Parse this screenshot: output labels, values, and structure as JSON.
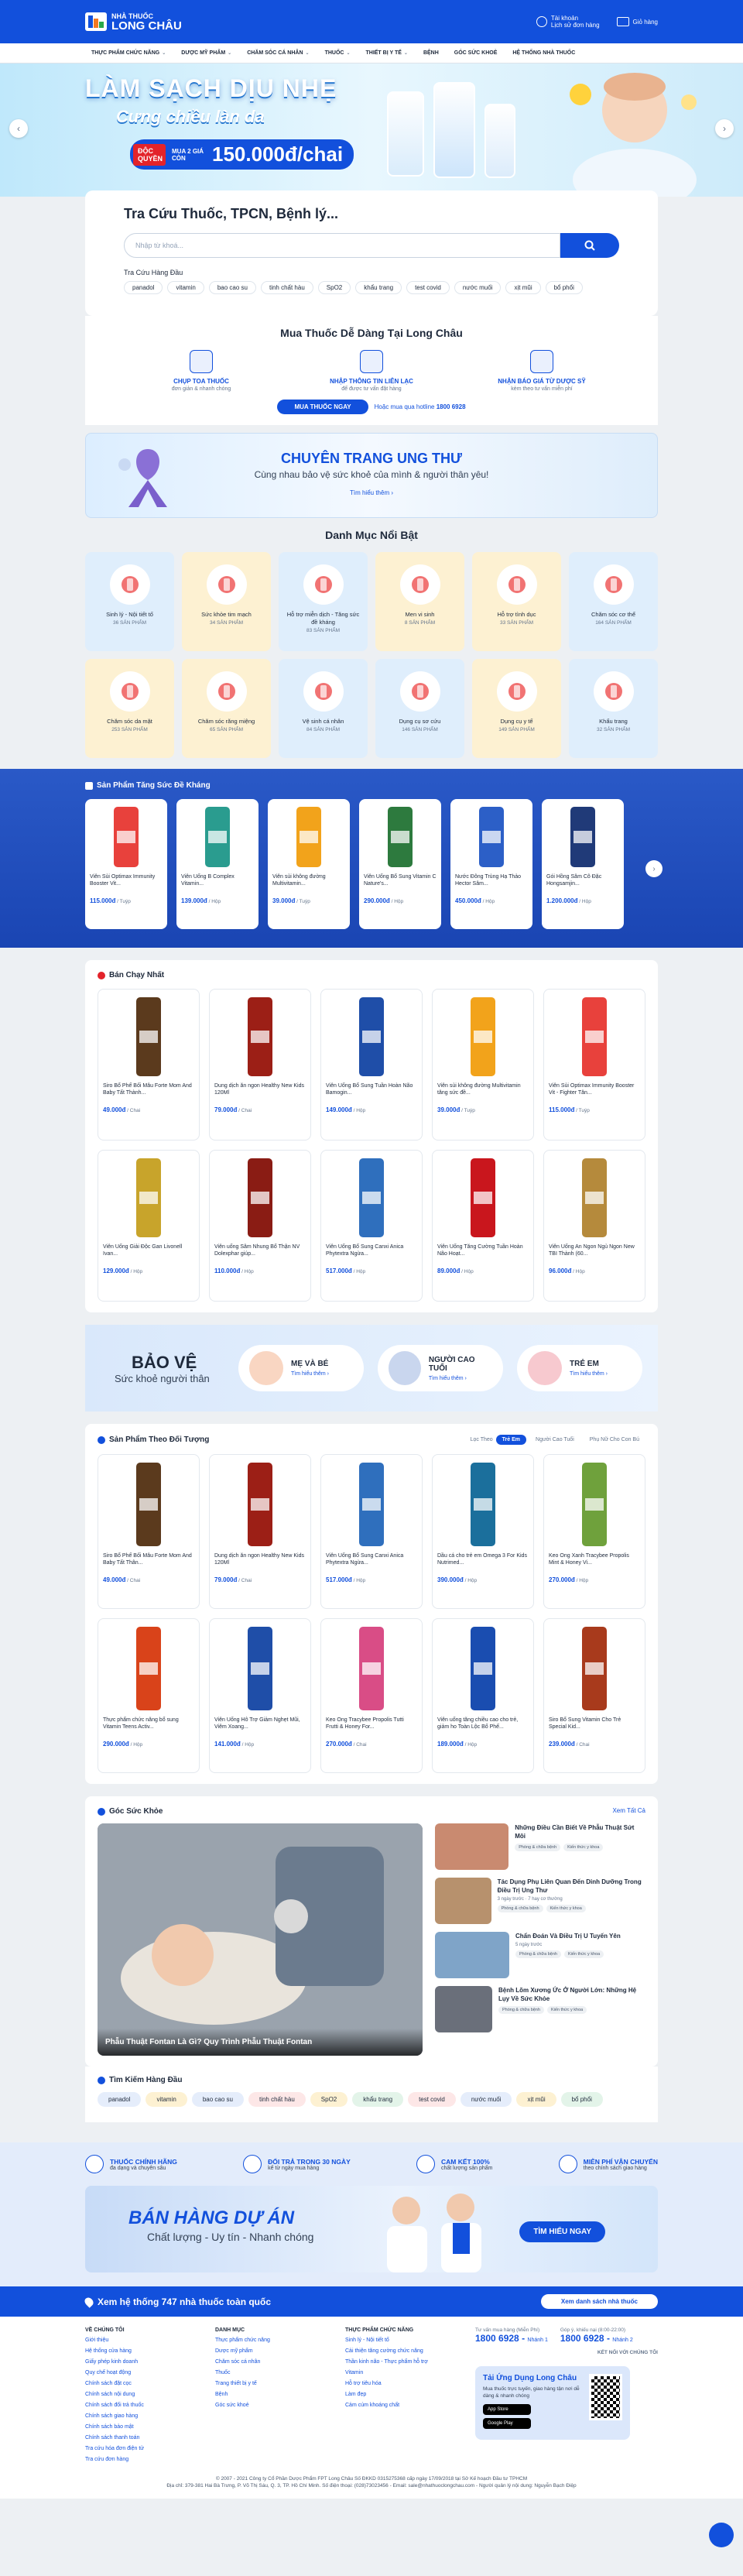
{
  "header": {
    "logo_small": "NHÀ THUỐC",
    "logo_big": "LONG CHÂU",
    "logo_brand": "FPT Retail",
    "account_line1": "Tài khoản",
    "account_line2": "Lịch sử đơn hàng",
    "cart": "Giỏ hàng"
  },
  "nav": [
    "THỰC PHẨM CHỨC NĂNG",
    "DƯỢC MỸ PHẨM",
    "CHĂM SÓC CÁ NHÂN",
    "THUỐC",
    "THIẾT BỊ Y TẾ",
    "BỆNH",
    "GÓC SỨC KHOẺ",
    "HỆ THỐNG NHÀ THUỐC"
  ],
  "banner": {
    "title": "LÀM SẠCH DỊU NHẸ",
    "subtitle": "Cưng chiều làn da",
    "tag": "ĐỘC QUYỀN",
    "deal": "MUA 2 GIÁ CÒN",
    "price": "150.000đ/chai"
  },
  "search": {
    "title": "Tra Cứu Thuốc, TPCN, Bệnh lý...",
    "placeholder": "Nhập từ khoá...",
    "top_label": "Tra Cứu Hàng Đầu",
    "chips": [
      "panadol",
      "vitamin",
      "bao cao su",
      "tinh chất hàu",
      "SpO2",
      "khẩu trang",
      "test covid",
      "nước muối",
      "xịt mũi",
      "bổ phổi"
    ]
  },
  "buy": {
    "title": "Mua Thuốc Dễ Dàng Tại Long Châu",
    "steps": [
      {
        "t": "CHỤP TOA THUỐC",
        "d": "đơn giản & nhanh chóng"
      },
      {
        "t": "NHẬP THÔNG TIN LIÊN LẠC",
        "d": "để được tư vấn đặt hàng"
      },
      {
        "t": "NHẬN BÁO GIÁ TỪ DƯỢC SỸ",
        "d": "kèm theo tư vấn miễn phí"
      }
    ],
    "button": "MUA THUỐC NGAY",
    "hotline_pre": "Hoặc mua qua hotline",
    "hotline": "1800 6928"
  },
  "cancer": {
    "title": "CHUYÊN TRANG UNG THƯ",
    "subtitle": "Cùng nhau bảo vệ sức khoẻ của mình & người thân yêu!",
    "link": "Tìm hiểu thêm ›"
  },
  "categories": {
    "title": "Danh Mục Nổi Bật",
    "items": [
      {
        "name": "Sinh lý - Nội tiết tố",
        "count": "36 SẢN PHẨM",
        "color": "#dfeefc",
        "icon": "gender-icon"
      },
      {
        "name": "Sức khỏe tim mạch",
        "count": "34 SẢN PHẨM",
        "color": "#fdf1d2",
        "icon": "heart-icon"
      },
      {
        "name": "Hỗ trợ miễn dịch - Tăng sức đề kháng",
        "count": "83 SẢN PHẨM",
        "color": "#dfeefc",
        "icon": "shield-icon"
      },
      {
        "name": "Men vi sinh",
        "count": "8 SẢN PHẨM",
        "color": "#fdf1d2",
        "icon": "stomach-icon"
      },
      {
        "name": "Hỗ trợ tình dục",
        "count": "33 SẢN PHẨM",
        "color": "#fdf1d2",
        "icon": "heart-hand-icon"
      },
      {
        "name": "Chăm sóc cơ thể",
        "count": "164 SẢN PHẨM",
        "color": "#dfeefc",
        "icon": "body-care-icon"
      },
      {
        "name": "Chăm sóc da mặt",
        "count": "253 SẢN PHẨM",
        "color": "#fdf1d2",
        "icon": "face-icon"
      },
      {
        "name": "Chăm sóc răng miệng",
        "count": "65 SẢN PHẨM",
        "color": "#fdf1d2",
        "icon": "toothbrush-icon"
      },
      {
        "name": "Vệ sinh cá nhân",
        "count": "84 SẢN PHẨM",
        "color": "#dfeefc",
        "icon": "sanitizer-icon"
      },
      {
        "name": "Dụng cụ sơ cứu",
        "count": "146 SẢN PHẨM",
        "color": "#dfeefc",
        "icon": "first-aid-icon"
      },
      {
        "name": "Dụng cụ y tế",
        "count": "149 SẢN PHẨM",
        "color": "#fdf1d2",
        "icon": "thermometer-icon"
      },
      {
        "name": "Khẩu trang",
        "count": "32 SẢN PHẨM",
        "color": "#dfeefc",
        "icon": "mask-icon"
      }
    ]
  },
  "immune": {
    "title": "Sản Phẩm Tăng Sức Đề Kháng",
    "items": [
      {
        "name": "Viên Sủi Optimax Immunity Booster Vit...",
        "price": "115.000đ",
        "unit": "/ Tuýp",
        "color": "#e8413c"
      },
      {
        "name": "Viên Uống B Complex Vitamin...",
        "price": "139.000đ",
        "unit": "/ Hộp",
        "color": "#2a9c8f"
      },
      {
        "name": "Viên sủi không đường Multivitamin...",
        "price": "39.000đ",
        "unit": "/ Tuýp",
        "color": "#f2a31b"
      },
      {
        "name": "Viên Uống Bổ Sung Vitamin C Nature's...",
        "price": "290.000đ",
        "unit": "/ Hộp",
        "color": "#2d7a3e"
      },
      {
        "name": "Nước Đông Trùng Hạ Thảo Hector Sâm...",
        "price": "450.000đ",
        "unit": "/ Hộp",
        "color": "#2c5fc7"
      },
      {
        "name": "Gói Hồng Sâm Cô Đặc Hongsamjin...",
        "price": "1.200.000đ",
        "unit": "/ Hộp",
        "color": "#203a78"
      }
    ]
  },
  "best": {
    "title": "Bán Chạy Nhất",
    "items": [
      {
        "name": "Siro Bổ Phế Bối Mẫu Forte Mom And Baby Tất Thành...",
        "price": "49.000đ",
        "unit": "/ Chai",
        "color": "#5b3a1d"
      },
      {
        "name": "Dung dịch ăn ngon Healthy New Kids 120Ml",
        "price": "79.000đ",
        "unit": "/ Chai",
        "color": "#9c1f16"
      },
      {
        "name": "Viên Uống Bổ Sung Tuần Hoàn Não Bamogin...",
        "price": "149.000đ",
        "unit": "/ Hộp",
        "color": "#1f4ea8"
      },
      {
        "name": "Viên sủi không đường Multivitamin tăng sức đề...",
        "price": "39.000đ",
        "unit": "/ Tuýp",
        "color": "#f2a31b"
      },
      {
        "name": "Viên Sủi Optimax Immunity Booster Vit - Fighter Tăn...",
        "price": "115.000đ",
        "unit": "/ Tuýp",
        "color": "#e8413c"
      },
      {
        "name": "Viên Uống Giải Độc Gan Livonell Ivan...",
        "price": "129.000đ",
        "unit": "/ Hộp",
        "color": "#c8a42b"
      },
      {
        "name": "Viên uống Sâm Nhung Bổ Thận NV Dolexphar giúp...",
        "price": "110.000đ",
        "unit": "/ Hộp",
        "color": "#8a1c14"
      },
      {
        "name": "Viên Uống Bổ Sung Canxi Anica Phytextra Ngừa...",
        "price": "517.000đ",
        "unit": "/ Hộp",
        "color": "#2f6fbd"
      },
      {
        "name": "Viên Uống Tăng Cường Tuần Hoàn Não Hoạt...",
        "price": "89.000đ",
        "unit": "/ Hộp",
        "color": "#c9161d"
      },
      {
        "name": "Viên Uống An Ngon Ngủ Ngon New TBI Thành (60...",
        "price": "96.000đ",
        "unit": "/ Hộp",
        "color": "#b58a3c"
      }
    ]
  },
  "protect": {
    "t1": "BẢO VỆ",
    "t2": "Sức khoẻ người thân",
    "boxes": [
      {
        "t": "MẸ VÀ BÉ",
        "l": "Tìm hiểu thêm ›",
        "c": "#f9d6c2"
      },
      {
        "t": "NGƯỜI CAO TUỔI",
        "l": "Tìm hiểu thêm ›",
        "c": "#c9d6ee"
      },
      {
        "t": "TRẺ EM",
        "l": "Tìm hiểu thêm ›",
        "c": "#f7c9cf"
      }
    ]
  },
  "target": {
    "title": "Sản Phẩm Theo Đối Tượng",
    "filter": "Lọc Theo",
    "tabs": [
      "Trẻ Em",
      "Người Cao Tuổi",
      "Phụ Nữ Cho Con Bú"
    ],
    "items": [
      {
        "name": "Siro Bổ Phế Bối Mẫu Forte Mom And Baby Tất Thân...",
        "price": "49.000đ",
        "unit": "/ Chai",
        "color": "#5b3a1d"
      },
      {
        "name": "Dung dịch ăn ngon Healthy New Kids 120Ml",
        "price": "79.000đ",
        "unit": "/ Chai",
        "color": "#9c1f16"
      },
      {
        "name": "Viên Uống Bổ Sung Canxi Anica Phytextra Ngừa...",
        "price": "517.000đ",
        "unit": "/ Hộp",
        "color": "#2f6fbd"
      },
      {
        "name": "Dầu cá cho trẻ em Omega 3 For Kids Nutrimed...",
        "price": "390.000đ",
        "unit": "/ Hộp",
        "color": "#1b6f9c"
      },
      {
        "name": "Keo Ong Xanh Tracybee Propolis Mint & Honey Vi...",
        "price": "270.000đ",
        "unit": "/ Hộp",
        "color": "#6fa13c"
      },
      {
        "name": "Thực phẩm chức năng bổ sung Vitamin Teens Activ...",
        "price": "290.000đ",
        "unit": "/ Hộp",
        "color": "#d9431a"
      },
      {
        "name": "Viên Uống Hỗ Trợ Giảm Nghẹt Mũi, Viêm Xoang...",
        "price": "141.000đ",
        "unit": "/ Hộp",
        "color": "#1f4ea8"
      },
      {
        "name": "Keo Ong Tracybee Propolis Tutti Frutti & Honey For...",
        "price": "270.000đ",
        "unit": "/ Chai",
        "color": "#d94d86"
      },
      {
        "name": "Viên uống tăng chiều cao cho trẻ, giảm ho Toàn Lộc Bổ Phế...",
        "price": "189.000đ",
        "unit": "/ Hộp",
        "color": "#1a4db0"
      },
      {
        "name": "Siro Bổ Sung Vitamin Cho Trẻ Special Kid...",
        "price": "239.000đ",
        "unit": "/ Chai",
        "color": "#a83a1c"
      }
    ]
  },
  "health": {
    "title": "Góc Sức Khỏe",
    "all": "Xem Tất Cả",
    "main": "Phẫu Thuật Fontan Là Gì? Quy Trình Phẫu Thuật Fontan",
    "items": [
      {
        "t": "Những Điều Cần Biết Về Phẫu Thuật Sứt Môi",
        "tags": [
          "Phòng & chữa bệnh",
          "Kiến thức y khoa"
        ],
        "meta": "",
        "c": "#c98a70"
      },
      {
        "t": "Tác Dụng Phụ Liên Quan Đến Dinh Dưỡng Trong Điều Trị Ung Thư",
        "tags": [
          "Phòng & chữa bệnh",
          "Kiến thức y khoa"
        ],
        "meta": "3 ngày trước · 7 hay cơ thường",
        "c": "#b7916d"
      },
      {
        "t": "Chẩn Đoán Và Điều Trị U Tuyến Yên",
        "tags": [
          "Phòng & chữa bệnh",
          "Kiến thức y khoa"
        ],
        "meta": "5 ngày trước",
        "c": "#7fa4c8"
      },
      {
        "t": "Bệnh Lõm Xương Ức Ở Người Lớn: Những Hệ Lụy Về Sức Khỏe",
        "tags": [
          "Phòng & chữa bệnh",
          "Kiến thức y khoa"
        ],
        "meta": "",
        "c": "#6a6f7a"
      }
    ]
  },
  "top_search": {
    "title": "Tìm Kiếm Hàng Đầu",
    "chips": [
      {
        "t": "panadol",
        "c": "#e5edfb"
      },
      {
        "t": "vitamin",
        "c": "#fdf1d2"
      },
      {
        "t": "bao cao su",
        "c": "#e5edfb"
      },
      {
        "t": "tinh chất hàu",
        "c": "#fde7e7"
      },
      {
        "t": "SpO2",
        "c": "#fdf1d2"
      },
      {
        "t": "khẩu trang",
        "c": "#e3f4e9"
      },
      {
        "t": "test covid",
        "c": "#fde7e7"
      },
      {
        "t": "nước muối",
        "c": "#e5edfb"
      },
      {
        "t": "xịt mũi",
        "c": "#fdf1d2"
      },
      {
        "t": "bổ phổi",
        "c": "#e3f4e9"
      }
    ]
  },
  "commit": [
    {
      "t": "THUỐC CHÍNH HÃNG",
      "d": "đa dạng và chuyên sâu"
    },
    {
      "t": "ĐỔI TRẢ TRONG 30 NGÀY",
      "d": "kể từ ngày mua hàng"
    },
    {
      "t": "CAM KẾT 100%",
      "d": "chất lượng sản phẩm"
    },
    {
      "t": "MIỄN PHÍ VẬN CHUYỂN",
      "d": "theo chính sách giao hàng"
    }
  ],
  "project": {
    "t1": "BÁN HÀNG DỰ ÁN",
    "t2": "Chất lượng - Uy tín - Nhanh chóng",
    "button": "TÌM HIỂU NGAY"
  },
  "pharmacy": {
    "label": "Xem hệ thống 747 nhà thuốc toàn quốc",
    "button": "Xem danh sách nhà thuốc"
  },
  "footer": {
    "cols": [
      {
        "h": "VỀ CHÚNG TÔI",
        "items": [
          "Giới thiệu",
          "Hệ thống cửa hàng",
          "Giấy phép kinh doanh",
          "Quy chế hoạt động",
          "Chính sách đặt cọc",
          "Chính sách nội dung",
          "Chính sách đổi trả thuốc",
          "Chính sách giao hàng",
          "Chính sách bảo mật",
          "Chính sách thanh toán",
          "Tra cứu hóa đơn điện tử",
          "Tra cứu đơn hàng"
        ]
      },
      {
        "h": "DANH MỤC",
        "items": [
          "Thực phẩm chức năng",
          "Dược mỹ phẩm",
          "Chăm sóc cá nhân",
          "Thuốc",
          "Trang thiết bị y tế",
          "Bệnh",
          "Góc sức khoẻ"
        ]
      },
      {
        "h": "THỰC PHẨM CHỨC NĂNG",
        "items": [
          "Sinh lý - Nội tiết tố",
          "Cải thiện tăng cường chức năng",
          "Thần kinh não - Thực phẩm hỗ trợ",
          "Vitamin",
          "Hỗ trợ tiêu hóa",
          "Làm đẹp",
          "Cảm cúm khoáng chất"
        ]
      }
    ],
    "call_lbl1": "Tư vấn mua hàng (Miễn Phí)",
    "call1": "1800 6928",
    "call1_sub": "Nhánh 1",
    "call_lbl2": "Góp ý, khiếu nại (8:00-22:00)",
    "call2": "1800 6928",
    "call2_sub": "Nhánh 2",
    "connect": "KẾT NỐI VỚI CHÚNG TÔI",
    "app_title": "Tải Ứng Dụng Long Châu",
    "app_desc": "Mua thuốc trực tuyến, giao hàng tận nơi dễ dàng & nhanh chóng",
    "store1": "App Store",
    "store2": "Google Play",
    "copyright": "© 2007 - 2021 Công ty Cổ Phần Dược Phẩm FPT Long Châu Số ĐKKD 0315275368 cấp ngày 17/09/2018 tại Sở Kế hoạch Đầu tư TPHCM",
    "address": "Địa chỉ: 379-381 Hai Bà Trưng, P. Võ Thị Sáu, Q. 3, TP. Hồ Chí Minh. Số điện thoại: (028)73023456 - Email: sale@nhathuoclongchau.com - Người quản lý nội dung: Nguyễn Bạch Điệp"
  }
}
